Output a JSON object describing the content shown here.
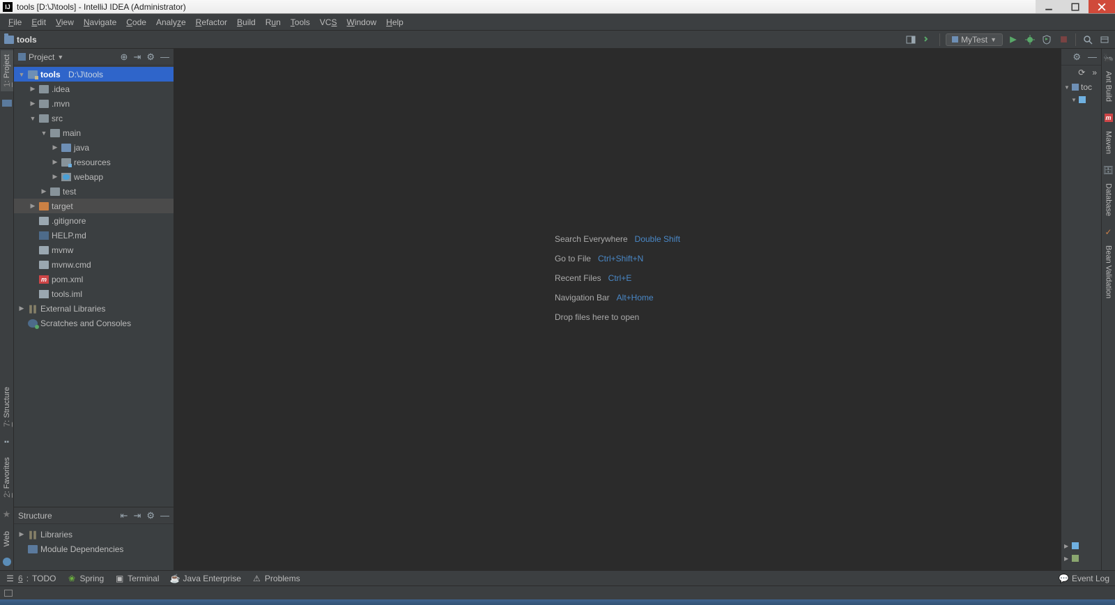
{
  "window": {
    "title": "tools [D:\\J\\tools] - IntelliJ IDEA (Administrator)"
  },
  "menus": [
    "File",
    "Edit",
    "View",
    "Navigate",
    "Code",
    "Analyze",
    "Refactor",
    "Build",
    "Run",
    "Tools",
    "VCS",
    "Window",
    "Help"
  ],
  "breadcrumb": {
    "project": "tools"
  },
  "run_config": {
    "name": "MyTest"
  },
  "project_tool": {
    "title": "Project",
    "root": {
      "name": "tools",
      "path": "D:\\J\\tools"
    },
    "nodes": {
      "idea": ".idea",
      "mvn": ".mvn",
      "src": "src",
      "main": "main",
      "java": "java",
      "resources": "resources",
      "webapp": "webapp",
      "test": "test",
      "target": "target",
      "gitignore": ".gitignore",
      "help": "HELP.md",
      "mvnw": "mvnw",
      "mvnwcmd": "mvnw.cmd",
      "pom": "pom.xml",
      "iml": "tools.iml",
      "extlibs": "External Libraries",
      "scratch": "Scratches and Consoles"
    }
  },
  "structure_tool": {
    "title": "Structure",
    "libraries": "Libraries",
    "module_deps": "Module Dependencies"
  },
  "editor_hints": [
    {
      "label": "Search Everywhere",
      "key": "Double Shift"
    },
    {
      "label": "Go to File",
      "key": "Ctrl+Shift+N"
    },
    {
      "label": "Recent Files",
      "key": "Ctrl+E"
    },
    {
      "label": "Navigation Bar",
      "key": "Alt+Home"
    },
    {
      "label": "Drop files here to open",
      "key": ""
    }
  ],
  "left_tabs": {
    "project": "1: Project",
    "structure": "7: Structure",
    "favorites": "2: Favorites",
    "web": "Web"
  },
  "right_tabs": {
    "ant": "Ant Build",
    "maven": "Maven",
    "database": "Database",
    "bean": "Bean Validation"
  },
  "right_mini": {
    "root": "toc"
  },
  "bottom_tools": {
    "todo": "TODO",
    "todo_num": "6",
    "spring": "Spring",
    "terminal": "Terminal",
    "jee": "Java Enterprise",
    "problems": "Problems",
    "event_log": "Event Log"
  }
}
